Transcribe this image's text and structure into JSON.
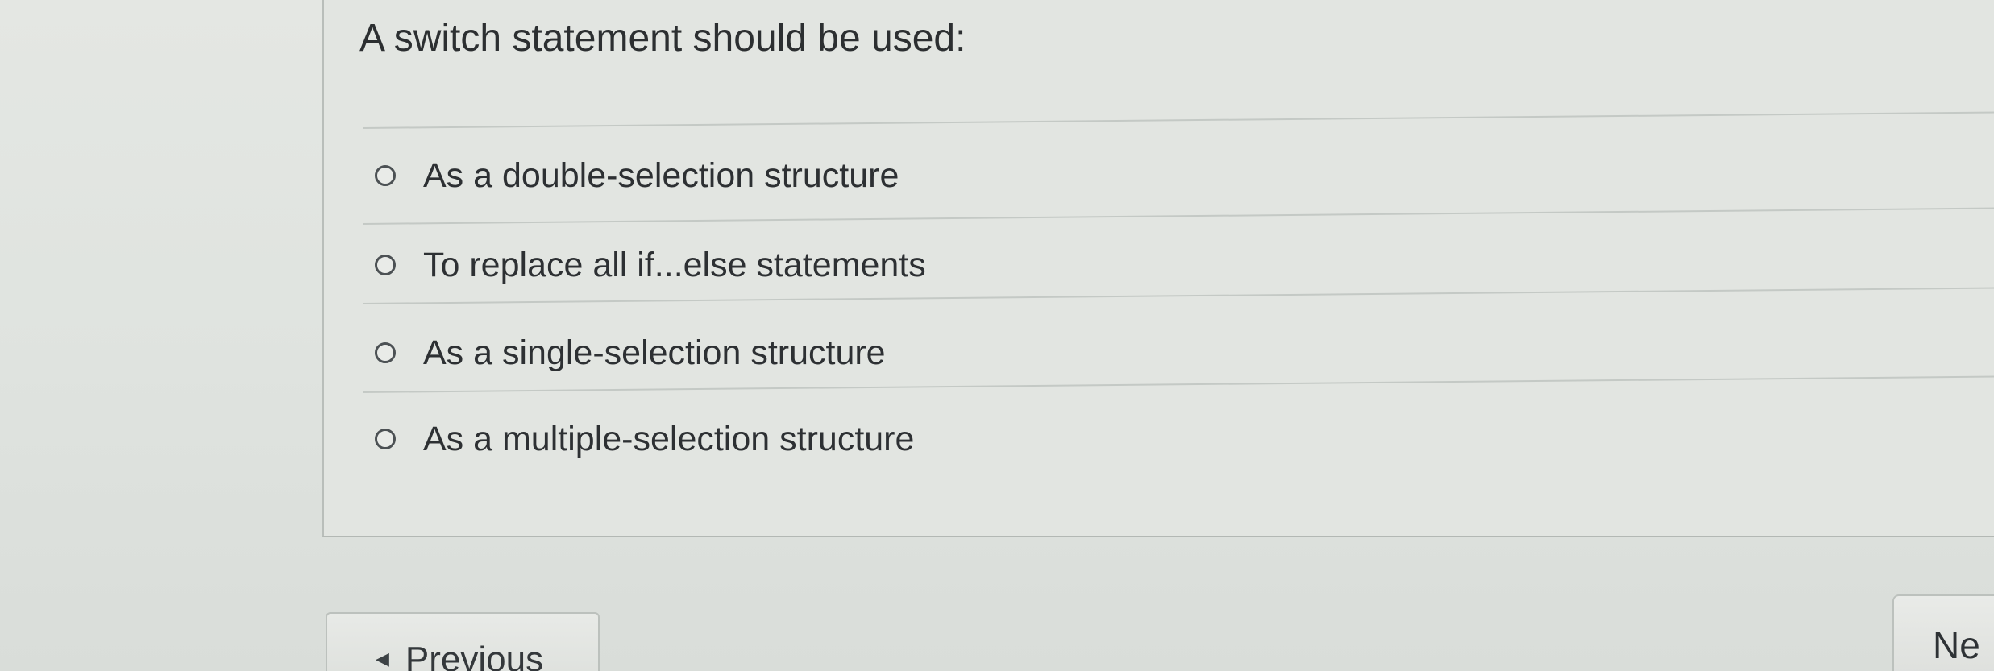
{
  "question": {
    "text": "A switch statement should be used:"
  },
  "answers": [
    {
      "label": "As a double-selection structure",
      "selected": false
    },
    {
      "label": "To replace all if...else statements",
      "selected": false
    },
    {
      "label": "As a single-selection structure",
      "selected": false
    },
    {
      "label": "As a multiple-selection structure",
      "selected": false
    }
  ],
  "navigation": {
    "previous_label": "Previous",
    "next_label": "Ne"
  },
  "icons": {
    "previous": "caret-left-icon",
    "radio": "radio-button-icon"
  }
}
